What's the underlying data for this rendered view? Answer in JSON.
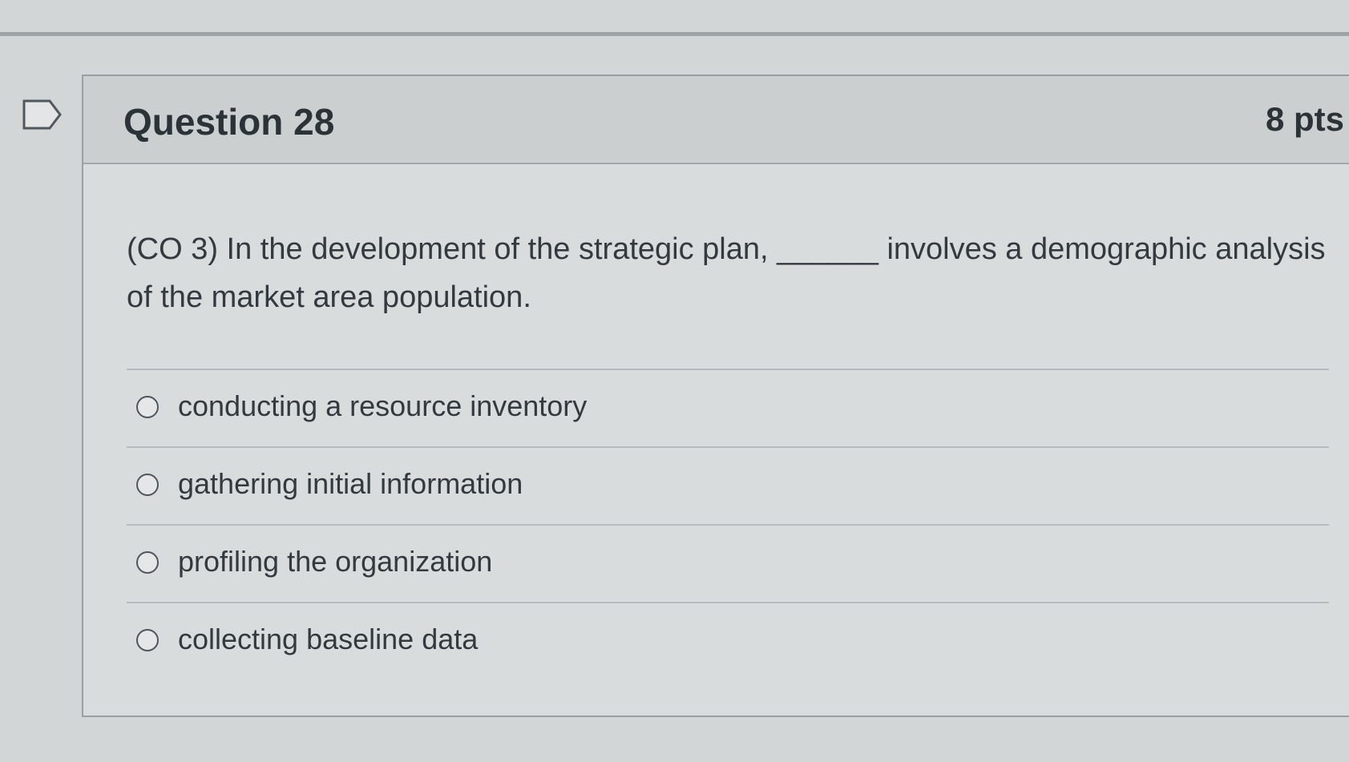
{
  "question": {
    "title": "Question 28",
    "points": "8 pts",
    "flag_icon": "flag-icon",
    "text": "(CO 3) In the development of the strategic plan, ______ involves a demographic analysis of the market area population."
  },
  "answers": [
    {
      "label": "conducting a resource inventory",
      "selected": false
    },
    {
      "label": "gathering initial information",
      "selected": false
    },
    {
      "label": "profiling the organization",
      "selected": false
    },
    {
      "label": "collecting baseline data",
      "selected": false
    }
  ]
}
